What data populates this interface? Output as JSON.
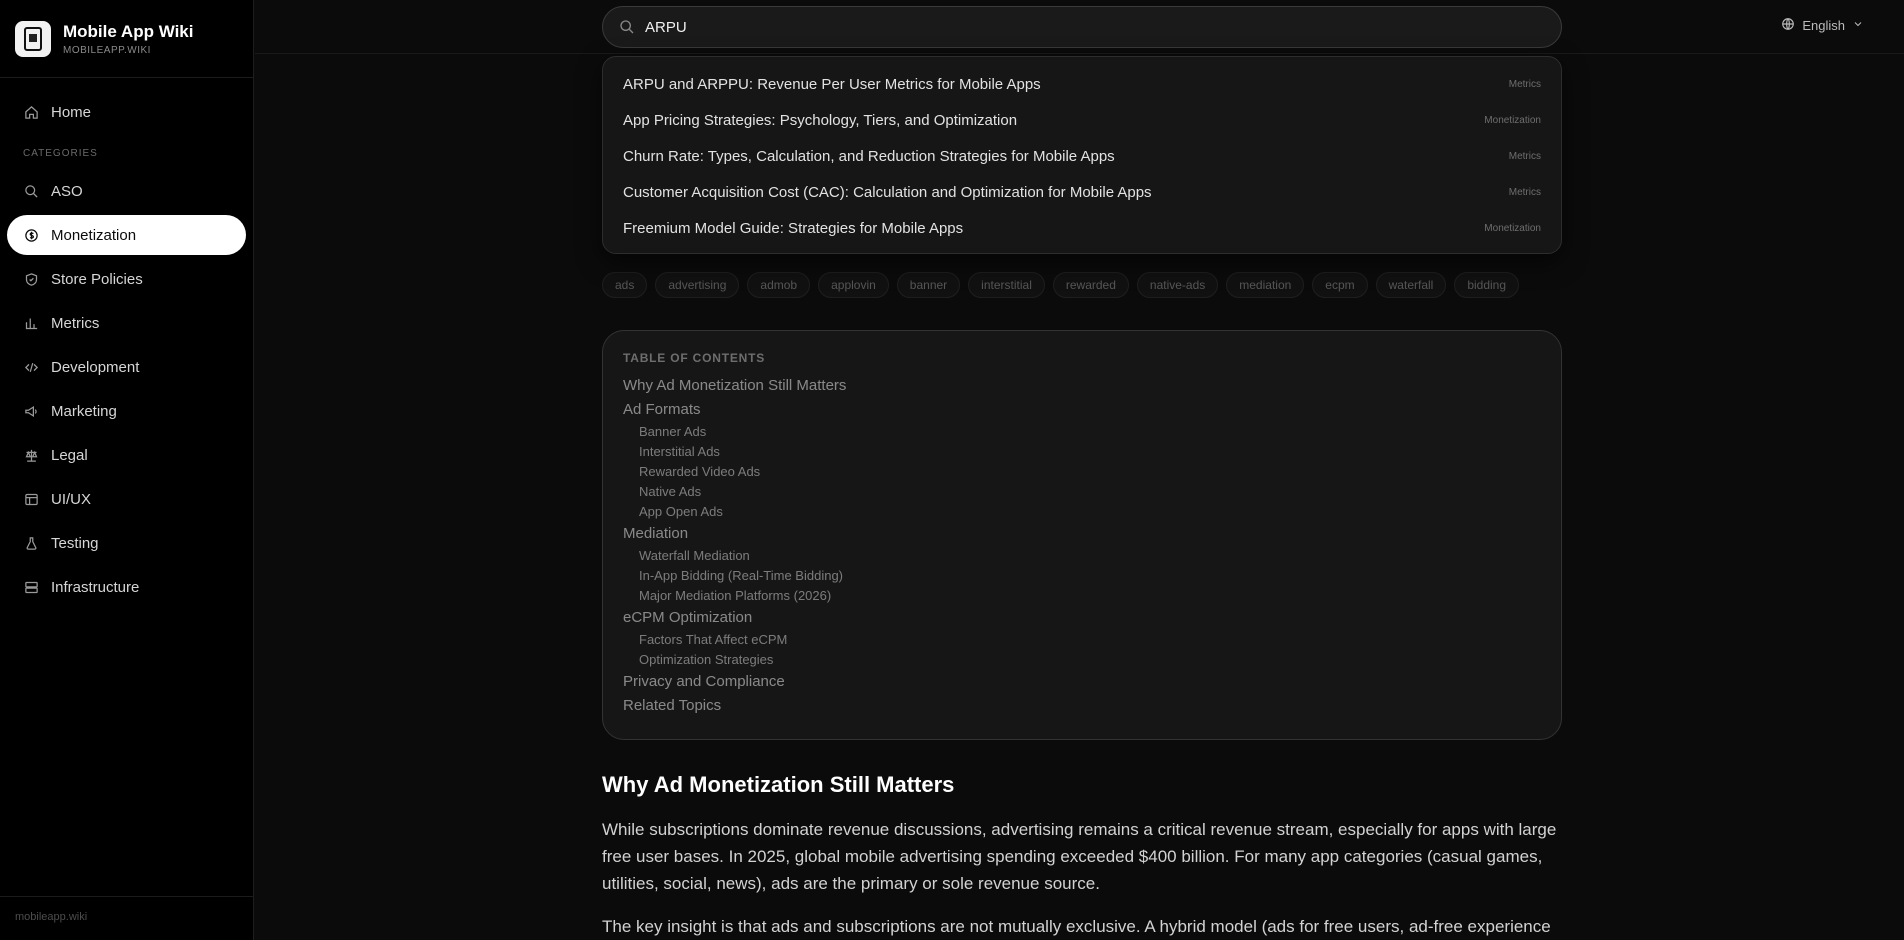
{
  "brand": {
    "title": "Mobile App Wiki",
    "subtitle": "MOBILEAPP.WIKI",
    "logo_text": "MOBILE APP WIKI"
  },
  "sidebar": {
    "home": "Home",
    "section_label": "CATEGORIES",
    "items": [
      {
        "label": "ASO",
        "icon": "search-icon"
      },
      {
        "label": "Monetization",
        "icon": "dollar-icon"
      },
      {
        "label": "Store Policies",
        "icon": "shield-icon"
      },
      {
        "label": "Metrics",
        "icon": "bar-chart-icon"
      },
      {
        "label": "Development",
        "icon": "code-icon"
      },
      {
        "label": "Marketing",
        "icon": "megaphone-icon"
      },
      {
        "label": "Legal",
        "icon": "scale-icon"
      },
      {
        "label": "UI/UX",
        "icon": "layout-icon"
      },
      {
        "label": "Testing",
        "icon": "flask-icon"
      },
      {
        "label": "Infrastructure",
        "icon": "server-icon"
      }
    ],
    "footer": "mobileapp.wiki"
  },
  "search": {
    "value": "ARPU"
  },
  "language": "English",
  "results": [
    {
      "title": "ARPU and ARPPU: Revenue Per User Metrics for Mobile Apps",
      "category": "Metrics"
    },
    {
      "title": "App Pricing Strategies: Psychology, Tiers, and Optimization",
      "category": "Monetization"
    },
    {
      "title": "Churn Rate: Types, Calculation, and Reduction Strategies for Mobile Apps",
      "category": "Metrics"
    },
    {
      "title": "Customer Acquisition Cost (CAC): Calculation and Optimization for Mobile Apps",
      "category": "Metrics"
    },
    {
      "title": "Freemium Model Guide: Strategies for Mobile Apps",
      "category": "Monetization"
    }
  ],
  "tags": [
    "ads",
    "advertising",
    "admob",
    "applovin",
    "banner",
    "interstitial",
    "rewarded",
    "native-ads",
    "mediation",
    "ecpm",
    "waterfall",
    "bidding"
  ],
  "toc": {
    "heading": "TABLE OF CONTENTS",
    "entries": [
      {
        "level": 1,
        "text": "Why Ad Monetization Still Matters"
      },
      {
        "level": 1,
        "text": "Ad Formats"
      },
      {
        "level": 2,
        "text": "Banner Ads"
      },
      {
        "level": 2,
        "text": "Interstitial Ads"
      },
      {
        "level": 2,
        "text": "Rewarded Video Ads"
      },
      {
        "level": 2,
        "text": "Native Ads"
      },
      {
        "level": 2,
        "text": "App Open Ads"
      },
      {
        "level": 1,
        "text": "Mediation"
      },
      {
        "level": 2,
        "text": "Waterfall Mediation"
      },
      {
        "level": 2,
        "text": "In-App Bidding (Real-Time Bidding)"
      },
      {
        "level": 2,
        "text": "Major Mediation Platforms (2026)"
      },
      {
        "level": 1,
        "text": "eCPM Optimization"
      },
      {
        "level": 2,
        "text": "Factors That Affect eCPM"
      },
      {
        "level": 2,
        "text": "Optimization Strategies"
      },
      {
        "level": 1,
        "text": "Privacy and Compliance"
      },
      {
        "level": 1,
        "text": "Related Topics"
      }
    ]
  },
  "article": {
    "heading": "Why Ad Monetization Still Matters",
    "paragraphs": [
      "While subscriptions dominate revenue discussions, advertising remains a critical revenue stream, especially for apps with large free user bases. In 2025, global mobile advertising spending exceeded $400 billion. For many app categories (casual games, utilities, social, news), ads are the primary or sole revenue source.",
      "The key insight is that ads and subscriptions are not mutually exclusive. A hybrid model (ads for free users, ad-free experience"
    ]
  }
}
